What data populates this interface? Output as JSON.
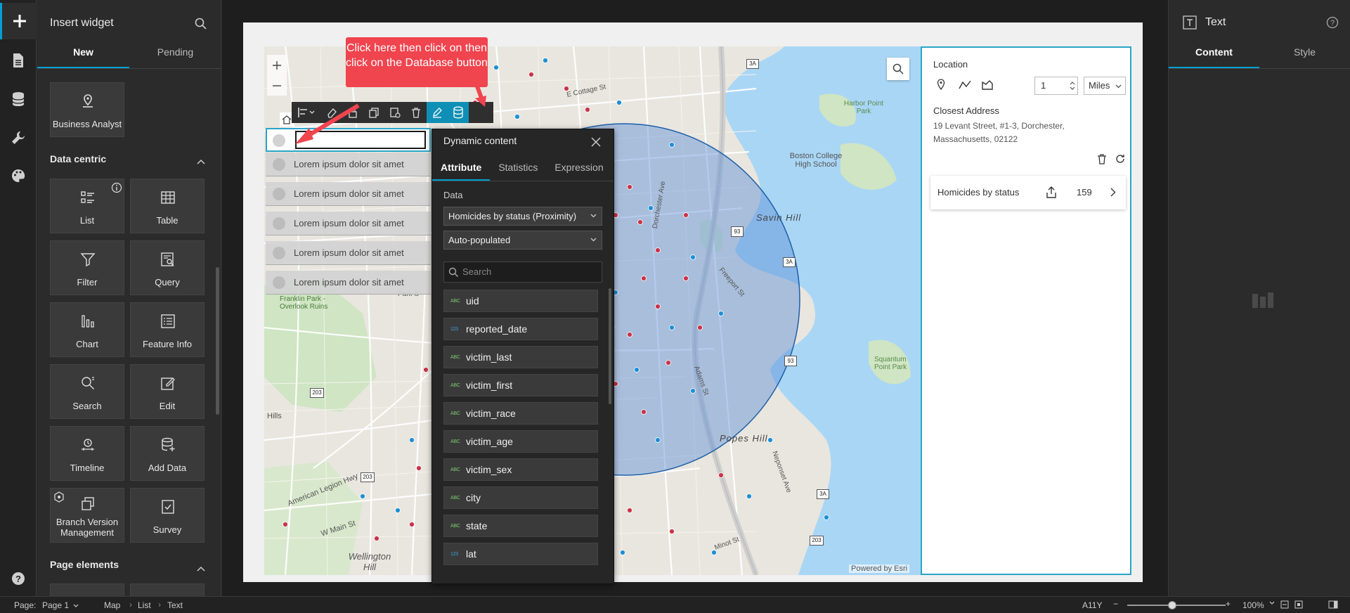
{
  "rail": {
    "items": [
      {
        "icon": "plus-icon"
      },
      {
        "icon": "page-icon"
      },
      {
        "icon": "database-icon"
      },
      {
        "icon": "wrench-icon"
      },
      {
        "icon": "palette-icon"
      },
      {
        "icon": "help-icon"
      }
    ]
  },
  "insert_panel": {
    "title": "Insert widget",
    "tabs": [
      {
        "label": "New"
      },
      {
        "label": "Pending"
      }
    ],
    "featured": {
      "label": "Business Analyst"
    },
    "sections": [
      {
        "title": "Data centric"
      },
      {
        "title": "Page elements"
      }
    ],
    "widgets": [
      {
        "label": "List"
      },
      {
        "label": "Table"
      },
      {
        "label": "Filter"
      },
      {
        "label": "Query"
      },
      {
        "label": "Chart"
      },
      {
        "label": "Feature Info"
      },
      {
        "label": "Search"
      },
      {
        "label": "Edit"
      },
      {
        "label": "Timeline"
      },
      {
        "label": "Add Data"
      },
      {
        "label": "Branch Version Management"
      },
      {
        "label": "Survey"
      }
    ]
  },
  "map": {
    "list_rows": [
      {
        "text": "Lorem ipsum dolor sit amet"
      },
      {
        "text": "Lorem ipsum dolor sit amet"
      },
      {
        "text": "Lorem ipsum dolor sit amet"
      },
      {
        "text": "Lorem ipsum dolor sit amet"
      },
      {
        "text": "Lorem ipsum dolor sit amet"
      }
    ],
    "attribution": "Powered by Esri",
    "labels": {
      "harbor": "Harbor Point Park",
      "boston_college": "Boston College High School",
      "savin_hill": "Savin Hill",
      "franklin": "Franklin Park - Overlook Ruins",
      "popes_hill": "Popes Hill",
      "squantum": "Squantum Point Park",
      "wellington": "Wellington Hill",
      "hills": "Hills",
      "am_legion": "American Legion Hwy",
      "w_main": "W Main St",
      "cottage": "E Cottage St",
      "adams": "Adams St",
      "freeport": "Freeport St",
      "dorchester": "Dorchester Ave",
      "neponset": "Neponset Ave",
      "minot": "Minot St",
      "park": "Park S"
    },
    "shields": [
      "3A",
      "93",
      "203"
    ]
  },
  "callout": {
    "text": "Click here then click on then click on the Database button"
  },
  "dynamic_content": {
    "title": "Dynamic content",
    "tabs": [
      {
        "label": "Attribute"
      },
      {
        "label": "Statistics"
      },
      {
        "label": "Expression"
      }
    ],
    "data_label": "Data",
    "data_source": "Homicides by status (Proximity)",
    "mode": "Auto-populated",
    "search_placeholder": "Search",
    "fields": [
      {
        "type": "ABC",
        "name": "uid"
      },
      {
        "type": "123",
        "name": "reported_date"
      },
      {
        "type": "ABC",
        "name": "victim_last"
      },
      {
        "type": "ABC",
        "name": "victim_first"
      },
      {
        "type": "ABC",
        "name": "victim_race"
      },
      {
        "type": "ABC",
        "name": "victim_age"
      },
      {
        "type": "ABC",
        "name": "victim_sex"
      },
      {
        "type": "ABC",
        "name": "city"
      },
      {
        "type": "ABC",
        "name": "state"
      },
      {
        "type": "123",
        "name": "lat"
      }
    ]
  },
  "near_me": {
    "location_label": "Location",
    "distance_value": "1",
    "distance_unit": "Miles",
    "closest_label": "Closest Address",
    "address": "19 Levant Street, #1-3, Dorchester, Massachusetts, 02122",
    "result_layer": "Homicides by status",
    "result_count": "159"
  },
  "settings_panel": {
    "title": "Text",
    "tabs": [
      {
        "label": "Content"
      },
      {
        "label": "Style"
      }
    ]
  },
  "statusbar": {
    "page_label": "Page:",
    "page_value": "Page 1",
    "breadcrumb": [
      "Map",
      "List",
      "Text"
    ],
    "screen": "A11Y",
    "zoom": "100%"
  },
  "colors": {
    "accent": "#00a0d4",
    "callout": "#f0444e",
    "buffer_fill": "#5b8fd6",
    "point_red": "#c9344a",
    "point_blue": "#1f8fd6",
    "water": "#a9d6f5"
  }
}
